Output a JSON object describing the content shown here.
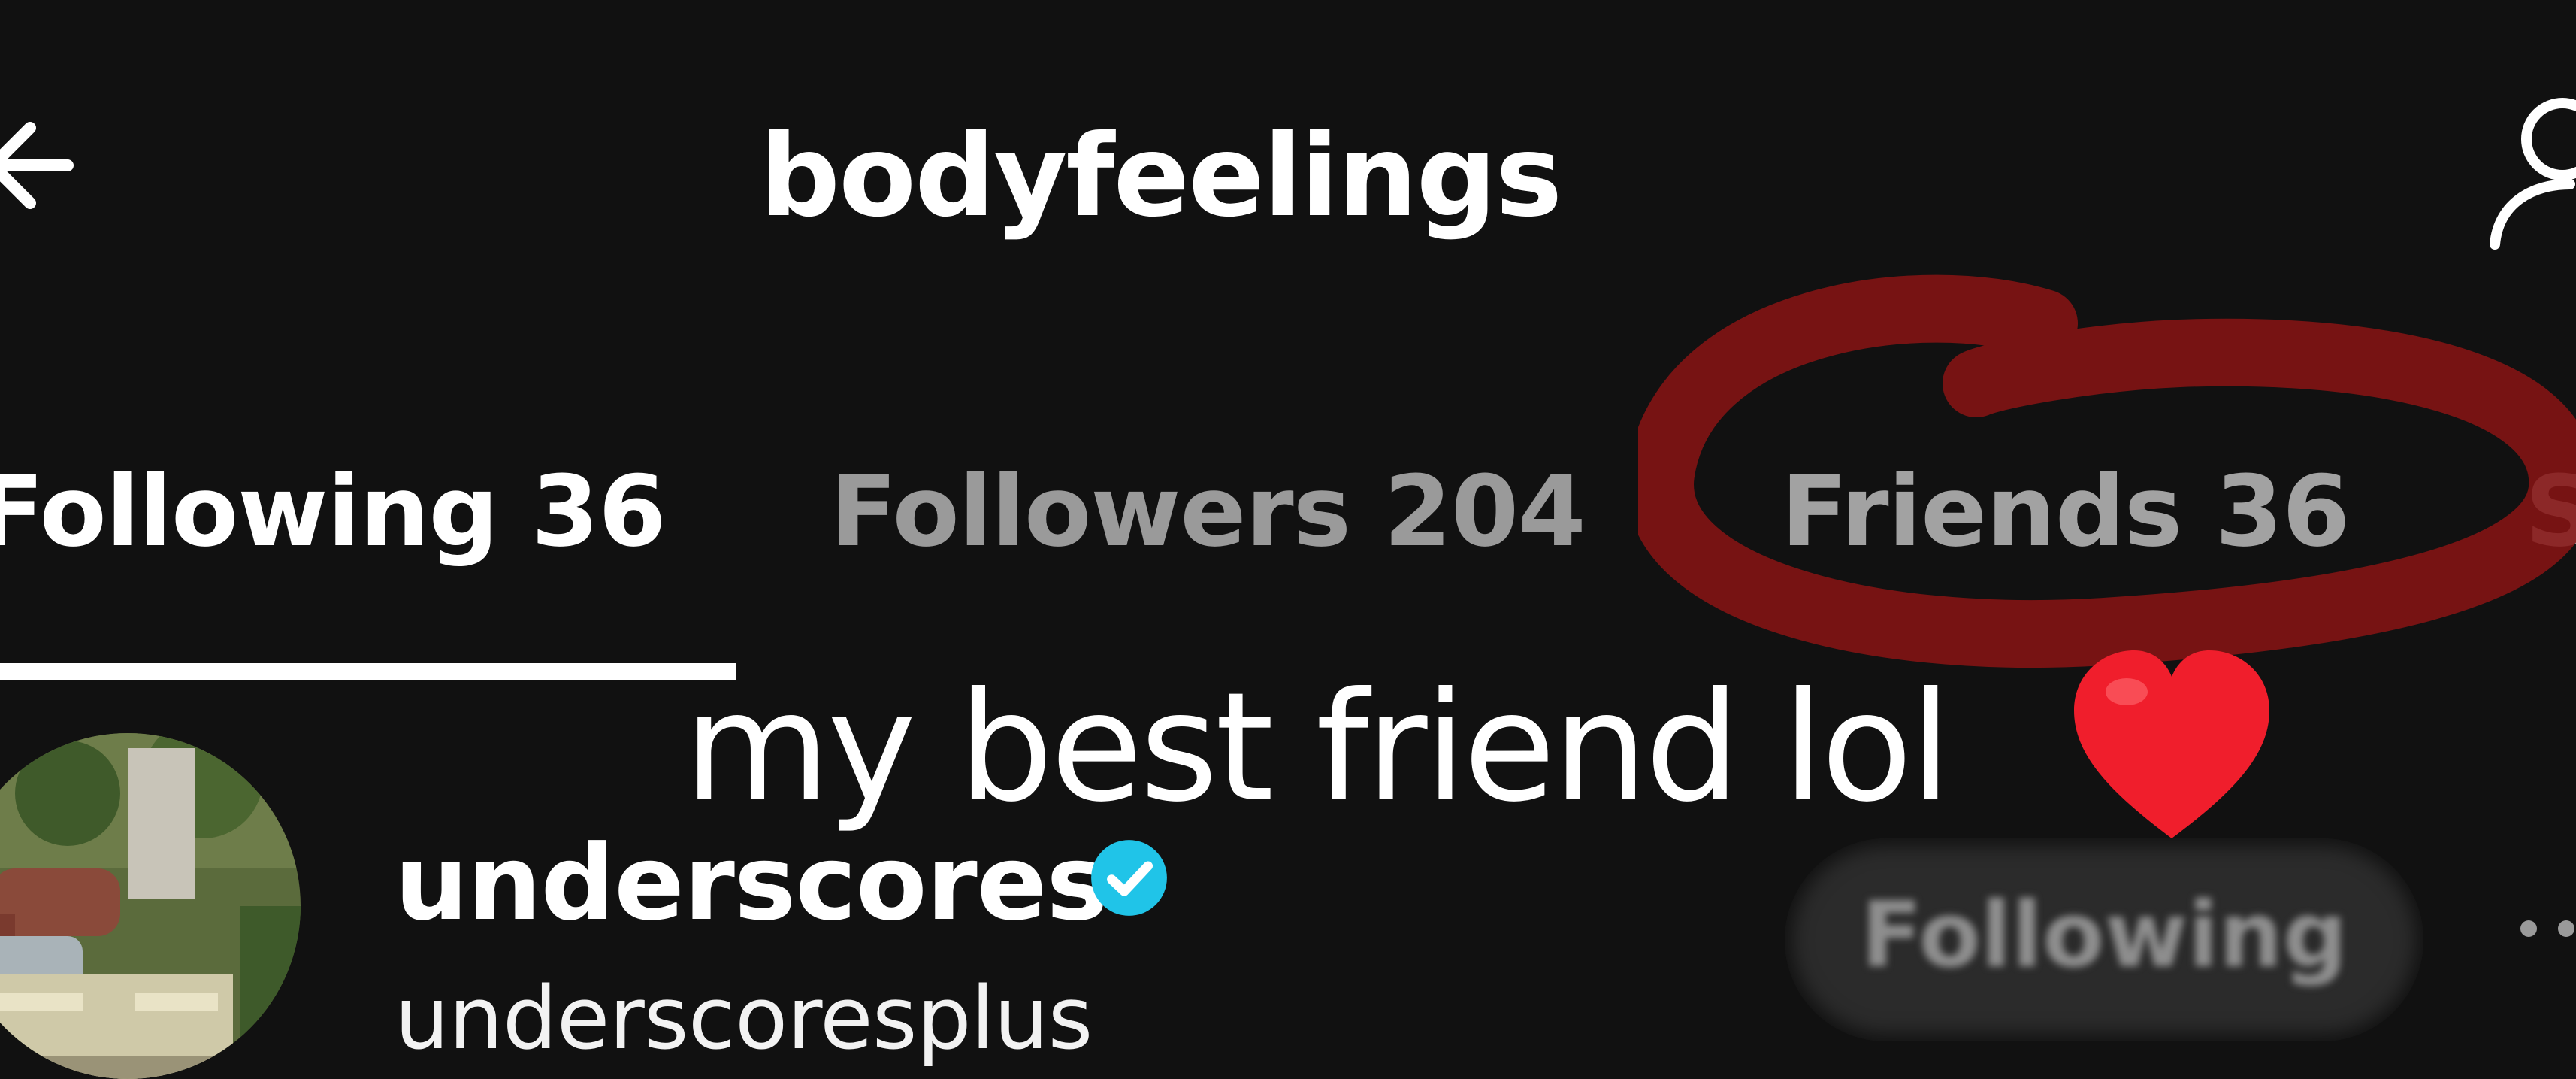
{
  "header": {
    "title": "bodyfeelings",
    "back_icon": "back-arrow-icon",
    "profile_icon": "add-friend-icon"
  },
  "tabs": [
    {
      "label": "Following 36",
      "active": true
    },
    {
      "label": "Followers 204",
      "active": false
    },
    {
      "label": "Friends 36",
      "active": false
    },
    {
      "label": "S",
      "active": false
    }
  ],
  "overlay": {
    "caption": "my best friend lol",
    "emoji": "red-heart",
    "scribble_color": "#8a1414"
  },
  "user": {
    "name": "underscores",
    "handle": "underscoresplus",
    "verified": true,
    "verified_color": "#20c4e8",
    "button_label": "Following",
    "more_icon": "more-dots-icon"
  }
}
